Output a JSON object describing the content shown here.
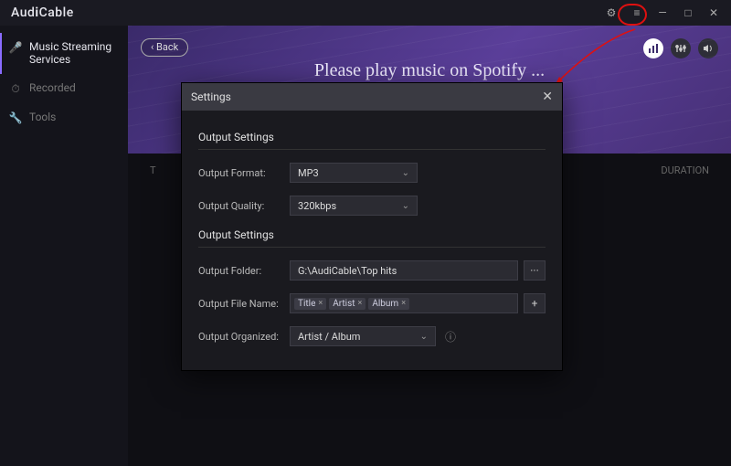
{
  "app": {
    "name_a": "Aud",
    "name_b": "i",
    "name_c": "Cable"
  },
  "window": {
    "gear": "⚙",
    "menu": "≡",
    "min": "—",
    "max": "□",
    "close": "✕"
  },
  "sidebar": {
    "items": [
      {
        "label": "Music Streaming Services",
        "icon": "🎤"
      },
      {
        "label": "Recorded",
        "icon": "⏱"
      },
      {
        "label": "Tools",
        "icon": "🔧"
      }
    ]
  },
  "hero": {
    "back": "Back",
    "title": "Please play music on Spotify ..."
  },
  "columns": {
    "c1": "T",
    "c2": "DURATION"
  },
  "dialog": {
    "title": "Settings",
    "section1": "Output Settings",
    "section2": "Output Settings",
    "format_label": "Output Format:",
    "format_value": "MP3",
    "quality_label": "Output Quality:",
    "quality_value": "320kbps",
    "folder_label": "Output Folder:",
    "folder_value": "G:\\AudiCable\\Top hits",
    "filename_label": "Output File Name:",
    "tags": [
      "Title",
      "Artist",
      "Album"
    ],
    "organized_label": "Output Organized:",
    "organized_value": "Artist / Album",
    "browse": "···",
    "add": "+",
    "info": "ⓘ"
  }
}
